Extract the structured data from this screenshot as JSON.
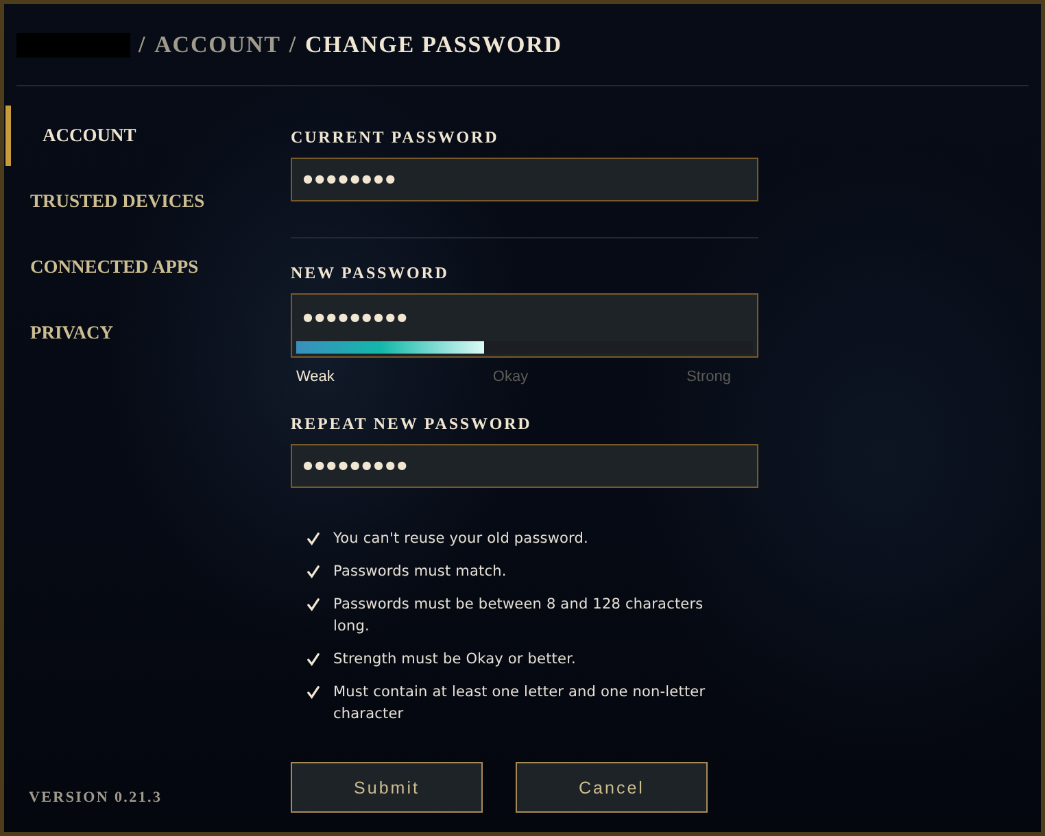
{
  "breadcrumb": [
    {
      "kind": "redacted"
    },
    {
      "kind": "separator",
      "label": "/"
    },
    {
      "kind": "link",
      "label": "ACCOUNT"
    },
    {
      "kind": "separator",
      "label": "/"
    },
    {
      "kind": "current",
      "label": "CHANGE PASSWORD"
    }
  ],
  "sidebar": {
    "items": [
      {
        "label": "ACCOUNT",
        "selected": true
      },
      {
        "label": "TRUSTED DEVICES",
        "selected": false
      },
      {
        "label": "CONNECTED APPS",
        "selected": false
      },
      {
        "label": "PRIVACY",
        "selected": false
      }
    ],
    "version": "VERSION 0.21.3"
  },
  "form": {
    "sections": [
      {
        "fields": [
          {
            "label": "CURRENT PASSWORD",
            "value": "●●●●●●●●"
          }
        ]
      },
      {
        "fields": [
          {
            "label": "NEW PASSWORD",
            "value": "●●●●●●●●●",
            "strength": {
              "level": 0.41,
              "labels": [
                {
                  "label": "Weak",
                  "selected": true
                },
                {
                  "label": "Okay",
                  "selected": false
                },
                {
                  "label": "Strong",
                  "selected": false
                }
              ]
            }
          },
          {
            "label": "REPEAT NEW PASSWORD",
            "value": "●●●●●●●●●"
          }
        ]
      }
    ],
    "requirements": [
      {
        "text": "You can't reuse your old password.",
        "met": true
      },
      {
        "text": "Passwords must match.",
        "met": true
      },
      {
        "text": "Passwords must be between 8 and 128 characters long.",
        "met": true
      },
      {
        "text": "Strength must be Okay or better.",
        "met": true
      },
      {
        "text": "Must contain at least one letter and one non-letter character",
        "met": true
      }
    ],
    "buttons": [
      {
        "label": "Submit"
      },
      {
        "label": "Cancel"
      }
    ]
  }
}
